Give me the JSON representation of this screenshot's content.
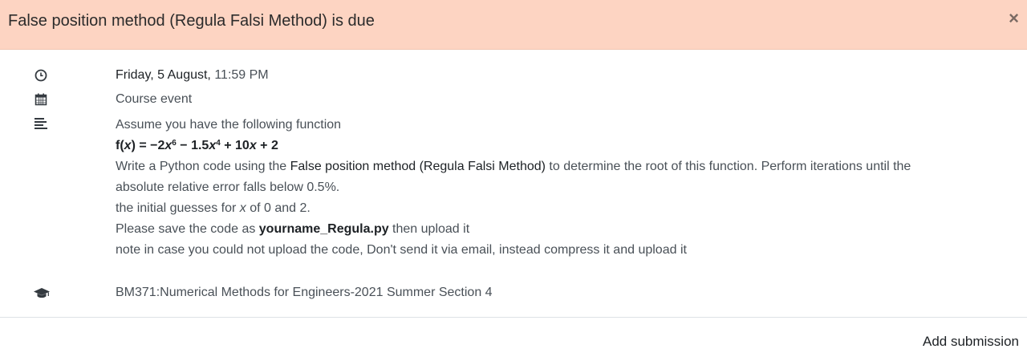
{
  "header": {
    "title": "False position method (Regula Falsi Method) is due",
    "close_label": "×"
  },
  "event": {
    "date_prefix": "Friday, 5 August,",
    "time": "11:59 PM",
    "type": "Course event",
    "description": {
      "intro": "Assume you have the following function",
      "formula": {
        "f": "f(",
        "x1": "x",
        "eq": ") = −2",
        "x2": "x",
        "e1": "6",
        "m1": " − 1.5",
        "x3": "x",
        "e2": "4",
        "m2": " + 10",
        "x4": "x",
        "m3": " + 2"
      },
      "line3_a": "Write a Python code using the ",
      "line3_method": "False position method (Regula Falsi Method)",
      "line3_b": " to determine the root of this function. Perform iterations until the",
      "line4": "absolute relative error falls below 0.5%.",
      "line5_a": "the initial guesses for ",
      "line5_x": "x",
      "line5_b": " of 0 and 2.",
      "line6_a": "Please save the code as ",
      "line6_file": "yourname_Regula.py",
      "line6_b": " then upload it",
      "line7": "note in case you could not upload the code, Don't send it via email, instead compress it and upload it"
    },
    "course": "BM371:Numerical Methods for Engineers-2021 Summer Section 4"
  },
  "footer": {
    "action_label": "Add submission"
  },
  "icons": {
    "time": "clock-icon",
    "type": "calendar-icon",
    "description": "align-left-icon",
    "course": "graduation-cap-icon",
    "close": "close-icon"
  }
}
